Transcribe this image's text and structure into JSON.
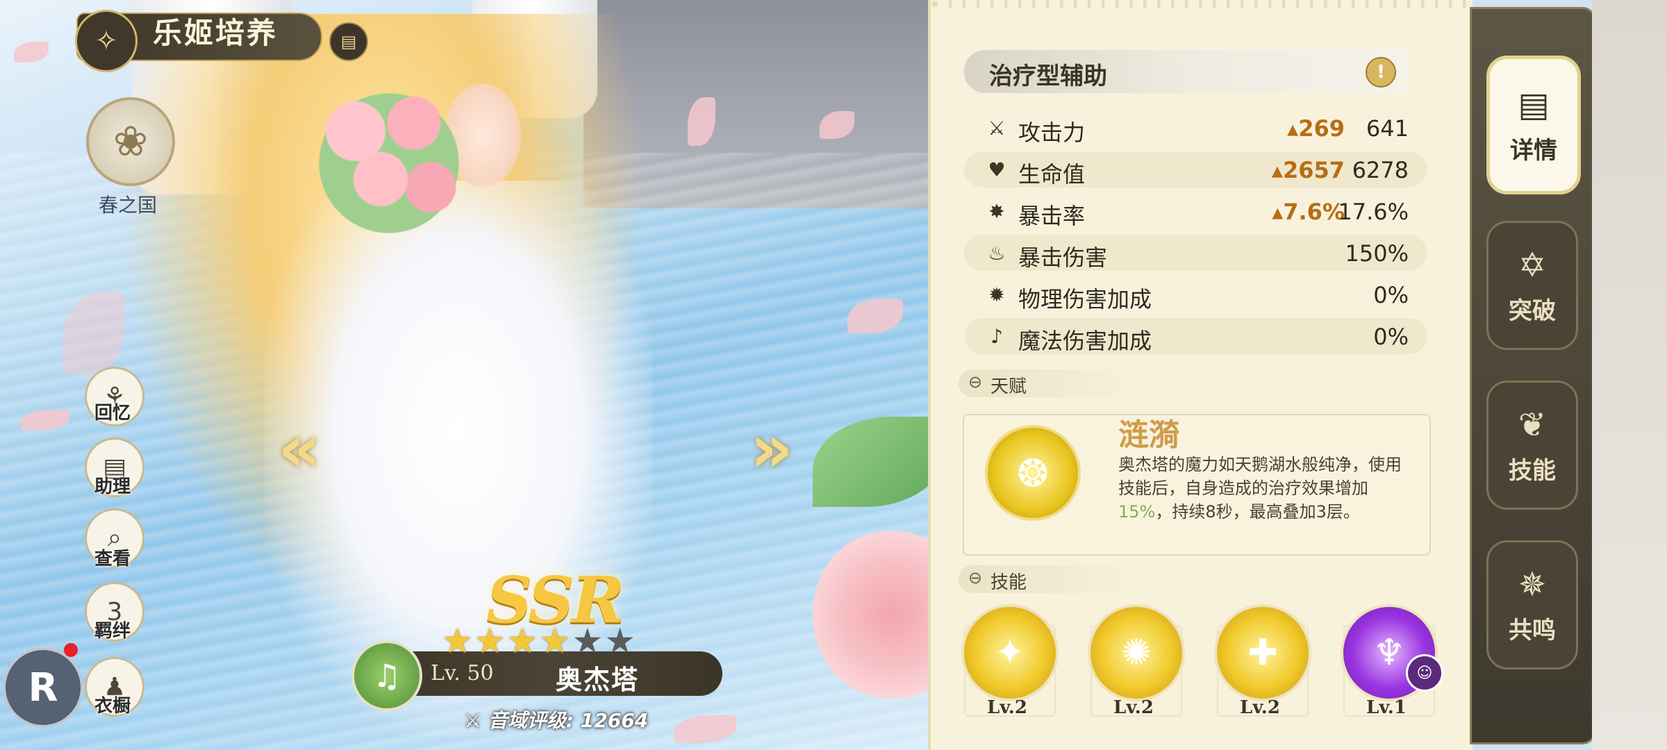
{
  "header": {
    "title": "乐姬培养",
    "emblem_icon": "lyre-emblem-icon",
    "doc_icon": "document-icon"
  },
  "region": {
    "label": "春之国",
    "icon": "flower-emblem-icon"
  },
  "side_menu": [
    {
      "key": "memory",
      "label": "回忆",
      "icon": "memory-icon",
      "glyph": "⚘"
    },
    {
      "key": "assist",
      "label": "助理",
      "icon": "assist-icon",
      "glyph": "▤"
    },
    {
      "key": "view",
      "label": "查看",
      "icon": "magnifier-icon",
      "glyph": "⌕"
    },
    {
      "key": "bond",
      "label": "羁绊",
      "icon": "heart-icon",
      "glyph": "3"
    },
    {
      "key": "wardrobe",
      "label": "衣橱",
      "icon": "wardrobe-icon",
      "glyph": "♟"
    }
  ],
  "r_button": {
    "label": "R"
  },
  "character": {
    "rarity": "SSR",
    "stars_total": 6,
    "stars_filled": 4,
    "level": "Lv. 50",
    "name": "奥杰塔",
    "rating": "音域评级: 12664"
  },
  "panel": {
    "role": "治疗型辅助",
    "stats": [
      {
        "name": "攻击力",
        "icon": "sword-icon",
        "glyph": "⚔",
        "bonus": "▴269",
        "value": "641"
      },
      {
        "name": "生命值",
        "icon": "heart-icon",
        "glyph": "♥",
        "bonus": "▴2657",
        "value": "6278"
      },
      {
        "name": "暴击率",
        "icon": "crit-star-icon",
        "glyph": "✸",
        "bonus": "▴7.6%",
        "value": "17.6%"
      },
      {
        "name": "暴击伤害",
        "icon": "crit-damage-icon",
        "glyph": "♨",
        "bonus": "",
        "value": "150%"
      },
      {
        "name": "物理伤害加成",
        "icon": "physical-damage-icon",
        "glyph": "✹",
        "bonus": "",
        "value": "0%"
      },
      {
        "name": "魔法伤害加成",
        "icon": "magic-damage-icon",
        "glyph": "♪",
        "bonus": "",
        "value": "0%"
      }
    ],
    "talent_section": "天赋",
    "talent": {
      "name": "涟漪",
      "desc_part1": "奥杰塔的魔力如天鹅湖水般纯净，使用技能后，自身造成的治疗效果增加",
      "desc_highlight": "15%",
      "desc_part2": "，持续8秒，最高叠加3层。"
    },
    "skills_section": "技能",
    "skills": [
      {
        "level": "Lv.2",
        "style": "gold"
      },
      {
        "level": "Lv.2",
        "style": "gold"
      },
      {
        "level": "Lv.2",
        "style": "gold"
      },
      {
        "level": "Lv.1",
        "style": "purple"
      }
    ]
  },
  "tabs": [
    {
      "label": "详情",
      "icon": "details-icon",
      "glyph": "▤",
      "active": true
    },
    {
      "label": "突破",
      "icon": "breakthrough-icon",
      "glyph": "✡",
      "active": false
    },
    {
      "label": "技能",
      "icon": "skill-icon",
      "glyph": "❦",
      "active": false
    },
    {
      "label": "共鸣",
      "icon": "resonance-icon",
      "glyph": "✵",
      "active": false
    }
  ],
  "colors": {
    "accent_gold": "#f3c936",
    "bonus_orange": "#b66d14",
    "highlight_green": "#7bb34f",
    "panel_bg": "#f8f2dc"
  }
}
